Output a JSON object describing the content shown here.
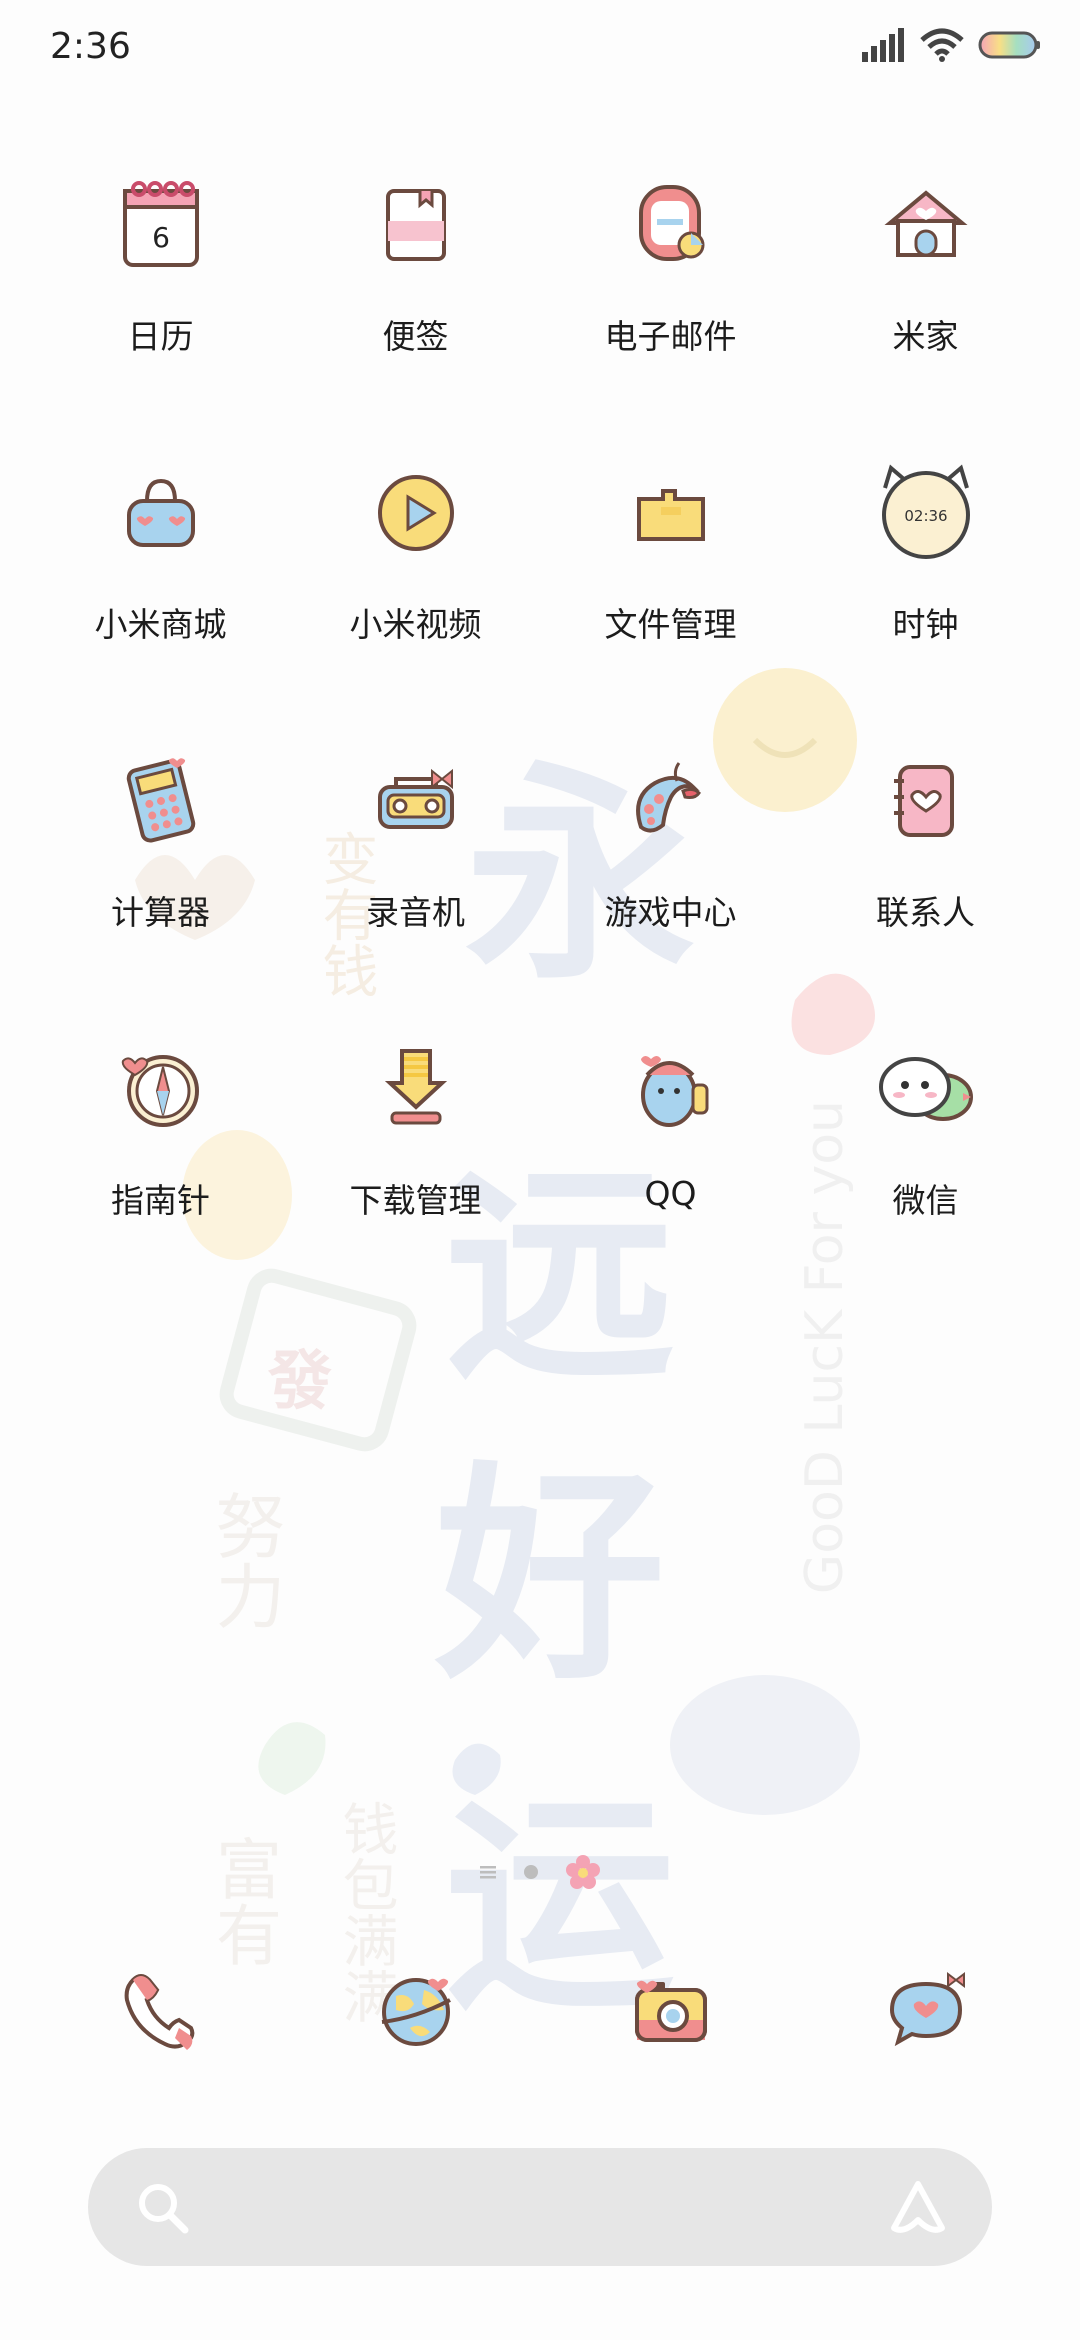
{
  "status_bar": {
    "time": "2:36"
  },
  "apps": [
    [
      {
        "label": "日历",
        "icon": "calendar-icon",
        "day": "6"
      },
      {
        "label": "便签",
        "icon": "notes-icon"
      },
      {
        "label": "电子邮件",
        "icon": "email-icon"
      },
      {
        "label": "米家",
        "icon": "home-icon"
      }
    ],
    [
      {
        "label": "小米商城",
        "icon": "shopping-bag-icon"
      },
      {
        "label": "小米视频",
        "icon": "video-play-icon"
      },
      {
        "label": "文件管理",
        "icon": "folder-icon"
      },
      {
        "label": "时钟",
        "icon": "clock-icon",
        "clock": "02:36"
      }
    ],
    [
      {
        "label": "计算器",
        "icon": "calculator-icon"
      },
      {
        "label": "录音机",
        "icon": "recorder-icon"
      },
      {
        "label": "游戏中心",
        "icon": "gamepad-icon"
      },
      {
        "label": "联系人",
        "icon": "contacts-icon"
      }
    ],
    [
      {
        "label": "指南针",
        "icon": "compass-icon"
      },
      {
        "label": "下载管理",
        "icon": "download-icon"
      },
      {
        "label": "QQ",
        "icon": "qq-icon"
      },
      {
        "label": "微信",
        "icon": "wechat-icon"
      }
    ]
  ],
  "dock": [
    {
      "icon": "phone-icon"
    },
    {
      "icon": "browser-globe-icon"
    },
    {
      "icon": "camera-icon"
    },
    {
      "icon": "messages-icon"
    }
  ],
  "wallpaper": {
    "big_text": [
      "永",
      "远",
      "好",
      "运"
    ],
    "side_text_right": "GooD LucK For you",
    "side_text_left_top": "变有钱",
    "side_text_left_mid": "努力",
    "side_text_bottom_a": "富有",
    "side_text_bottom_b": "钱包满满",
    "mahjong": "發"
  },
  "colors": {
    "accent_pink": "#f4a3b4",
    "accent_blue": "#a8d3ee",
    "accent_yellow": "#f9dc7a",
    "outline": "#6b4a3f"
  }
}
